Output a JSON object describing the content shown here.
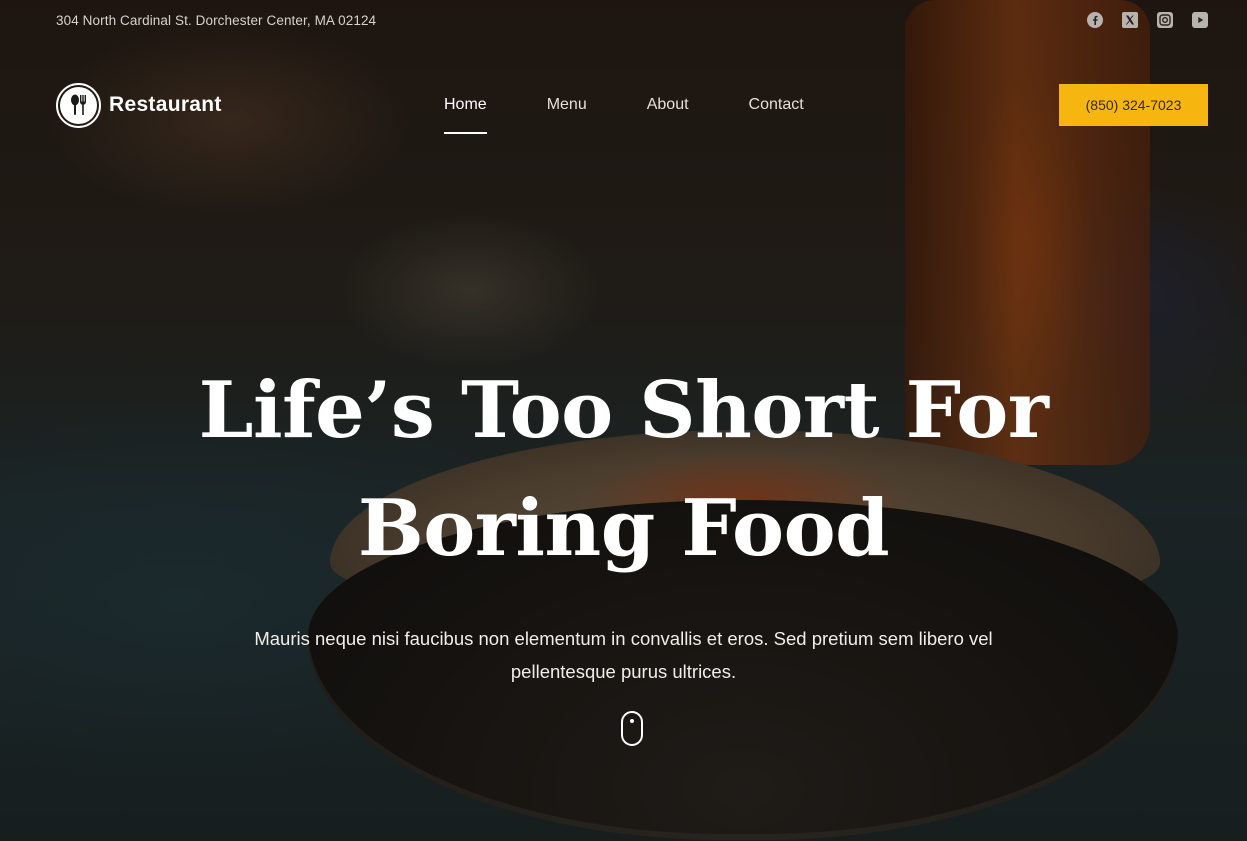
{
  "topbar": {
    "address": "304 North Cardinal St. Dorchester Center, MA 02124",
    "socials": [
      {
        "icon": "facebook-icon"
      },
      {
        "icon": "x-twitter-icon"
      },
      {
        "icon": "instagram-icon"
      },
      {
        "icon": "youtube-icon"
      }
    ]
  },
  "header": {
    "brand": "Restaurant",
    "logo_icon": "spoon-fork-icon",
    "nav": [
      {
        "label": "Home",
        "active": true
      },
      {
        "label": "Menu",
        "active": false
      },
      {
        "label": "About",
        "active": false
      },
      {
        "label": "Contact",
        "active": false
      }
    ],
    "phone": "(850) 324-7023"
  },
  "hero": {
    "headline": "Life’s Too Short For Boring Food",
    "subtext": "Mauris neque nisi faucibus non elementum in convallis et eros. Sed pretium sem libero vel pellentesque purus ultrices.",
    "scroll_icon": "mouse-scroll-icon"
  },
  "colors": {
    "accent": "#f6b60f",
    "text": "#ffffff"
  }
}
